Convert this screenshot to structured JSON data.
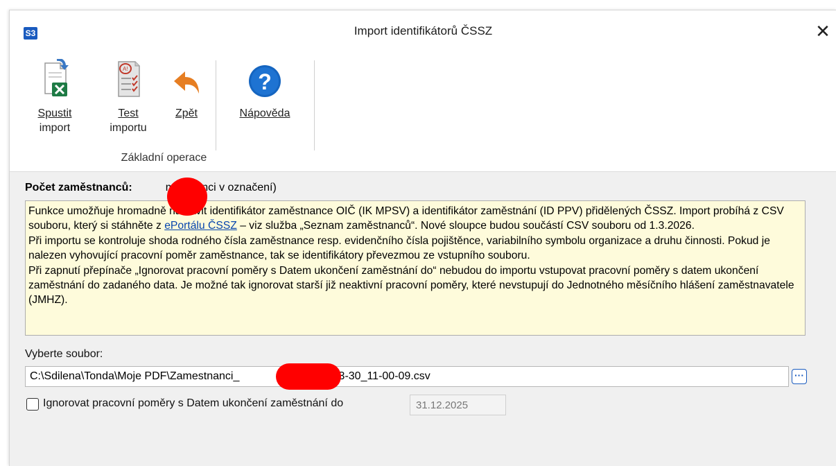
{
  "window": {
    "app_badge": "S3",
    "title": "Import identifikátorů ČSSZ",
    "close_glyph": "✕"
  },
  "ribbon": {
    "buttons": [
      {
        "line1": "Spustit",
        "line2": "import",
        "icon": "excel-import-icon"
      },
      {
        "line1": "Test",
        "line2": "importu",
        "icon": "checklist-icon"
      },
      {
        "line1": "Zpět",
        "line2": "",
        "icon": "undo-arrow-icon"
      },
      {
        "line1": "Nápověda",
        "line2": "",
        "icon": "help-icon"
      }
    ],
    "group_label": "Základní operace"
  },
  "count": {
    "label": "Počet zaměstnanců:",
    "suffix": "městnanci v označení)"
  },
  "info": {
    "p1_before": "Funkce umožňuje hromadně nastavit identifikátor zaměstnance OIČ (IK MPSV) a identifikátor zaměstnání (ID PPV) přidělených ČSSZ. Import probíhá z CSV souboru, který si stáhněte z ",
    "p1_link": "ePortálu ČSSZ",
    "p1_after": " – viz služba „Seznam zaměstnanců“. Nové sloupce budou součástí CSV souboru od 1.3.2026.",
    "p2": "Při importu se kontroluje shoda rodného čísla zaměstnance resp. evidenčního čísla pojištěnce, variabilního symbolu organizace a druhu činnosti. Pokud je nalezen vyhovující pracovní poměr zaměstnance, tak se identifikátory převezmou ze vstupního souboru.",
    "p3": "Při zapnutí přepínače „Ignorovat pracovní poměry s Datem ukončení zaměstnání do“ nebudou do importu vstupovat pracovní poměry s datem ukončení zaměstnání do zadaného data. Je možné tak ignorovat starší již neaktivní pracovní poměry, které nevstupují do Jednotného měsíčního hlášení zaměstnavatele (JMHZ)."
  },
  "file": {
    "label": "Vyberte soubor:",
    "value": "C:\\Sdilena\\Tonda\\Moje PDF\\Zamestnanci_                     2026-03-30_11-00-09.csv",
    "browse_label": "···"
  },
  "ignore": {
    "checked": false,
    "label": "Ignorovat pracovní poměry s Datem ukončení zaměstnání do",
    "date": "31.12.2025"
  },
  "colors": {
    "info_bg": "#fefbdb",
    "accent": "#1a5bbf",
    "redaction": "#ff0000",
    "undo_arrow": "#e67e22"
  }
}
